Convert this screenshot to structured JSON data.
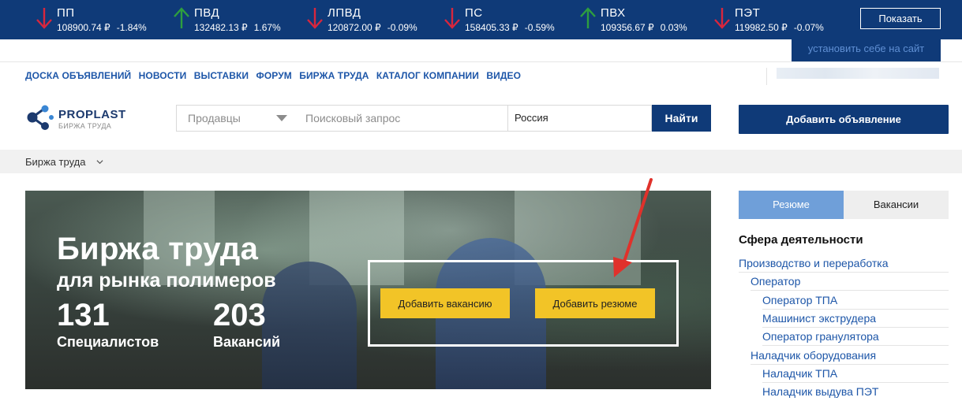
{
  "ticker": [
    {
      "name": "ПП",
      "price": "108900.74 ₽",
      "change": "-1.84%",
      "direction": "down"
    },
    {
      "name": "ПВД",
      "price": "132482.13 ₽",
      "change": "1.67%",
      "direction": "up"
    },
    {
      "name": "ЛПВД",
      "price": "120872.00 ₽",
      "change": "-0.09%",
      "direction": "down"
    },
    {
      "name": "ПС",
      "price": "158405.33 ₽",
      "change": "-0.59%",
      "direction": "down"
    },
    {
      "name": "ПВХ",
      "price": "109356.67 ₽",
      "change": "0.03%",
      "direction": "up"
    },
    {
      "name": "ПЭТ",
      "price": "119982.50 ₽",
      "change": "-0.07%",
      "direction": "down"
    }
  ],
  "ticker_show_label": "Показать",
  "install_label": "установить себе на сайт",
  "nav": [
    "ДОСКА ОБЪЯВЛЕНИЙ",
    "НОВОСТИ",
    "ВЫСТАВКИ",
    "ФОРУМ",
    "БИРЖА ТРУДА",
    "КАТАЛОГ КОМПАНИИ",
    "ВИДЕО"
  ],
  "logo": {
    "brand": "PROPLAST",
    "sub": "БИРЖА ТРУДА"
  },
  "search": {
    "category_value": "Продавцы",
    "placeholder": "Поисковый запрос",
    "region_value": "Россия",
    "find_label": "Найти"
  },
  "add_ad_label": "Добавить объявление",
  "breadcrumb": "Биржа труда",
  "hero": {
    "title": "Биржа труда",
    "subtitle": "для рынка полимеров",
    "specialists_count": "131",
    "specialists_label": "Специалистов",
    "vacancies_count": "203",
    "vacancies_label": "Вакансий",
    "add_vacancy_label": "Добавить вакансию",
    "add_resume_label": "Добавить резюме"
  },
  "tabs": {
    "resume": "Резюме",
    "vacancies": "Вакансии"
  },
  "sidebar": {
    "title": "Сфера деятельности",
    "categories": [
      {
        "label": "Производство и переработка",
        "level": 0
      },
      {
        "label": "Оператор",
        "level": 1
      },
      {
        "label": "Оператор ТПА",
        "level": 2
      },
      {
        "label": "Машинист экструдера",
        "level": 2
      },
      {
        "label": "Оператор гранулятора",
        "level": 2
      },
      {
        "label": "Наладчик оборудования",
        "level": 1
      },
      {
        "label": "Наладчик ТПА",
        "level": 2
      },
      {
        "label": "Наладчик выдува ПЭТ",
        "level": 2
      }
    ]
  },
  "colors": {
    "navy": "#0f3a78",
    "link": "#1d56a8",
    "yellow": "#f2c427",
    "tab_active": "#6f9fd9",
    "up": "#2e9e3f",
    "down": "#d8263d"
  }
}
